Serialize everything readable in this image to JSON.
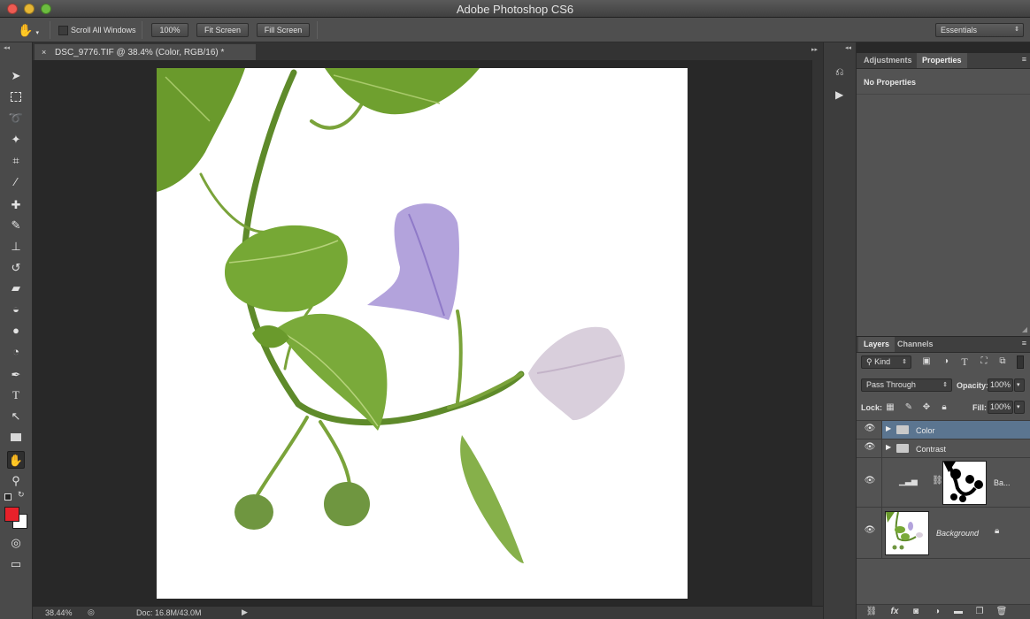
{
  "app": {
    "title": "Adobe Photoshop CS6"
  },
  "options_bar": {
    "scroll_all_windows": "Scroll All Windows",
    "zoom_100": "100%",
    "fit_screen": "Fit Screen",
    "fill_screen": "Fill Screen",
    "workspace": "Essentials"
  },
  "document": {
    "tab_title": "DSC_9776.TIF @ 38.4% (Color, RGB/16) *",
    "zoom": "38.44%",
    "doc_info": "Doc: 16.8M/43.0M"
  },
  "properties_panel": {
    "tabs": [
      "Adjustments",
      "Properties"
    ],
    "message": "No Properties"
  },
  "layers_panel": {
    "tabs": [
      "Layers",
      "Channels"
    ],
    "filter_kind": "Kind",
    "blend_mode": "Pass Through",
    "opacity_label": "Opacity:",
    "opacity_value": "100%",
    "lock_label": "Lock:",
    "fill_label": "Fill:",
    "fill_value": "100%",
    "layers": [
      {
        "name": "Color",
        "type": "group",
        "selected": true
      },
      {
        "name": "Contrast",
        "type": "group",
        "selected": false
      },
      {
        "name": "Ba...",
        "type": "adjustment",
        "selected": false
      },
      {
        "name": "Background",
        "type": "pixel",
        "selected": false
      }
    ]
  },
  "colors": {
    "foreground": "#e8212a",
    "background": "#ffffff",
    "selected_layer": "#5b7590"
  }
}
